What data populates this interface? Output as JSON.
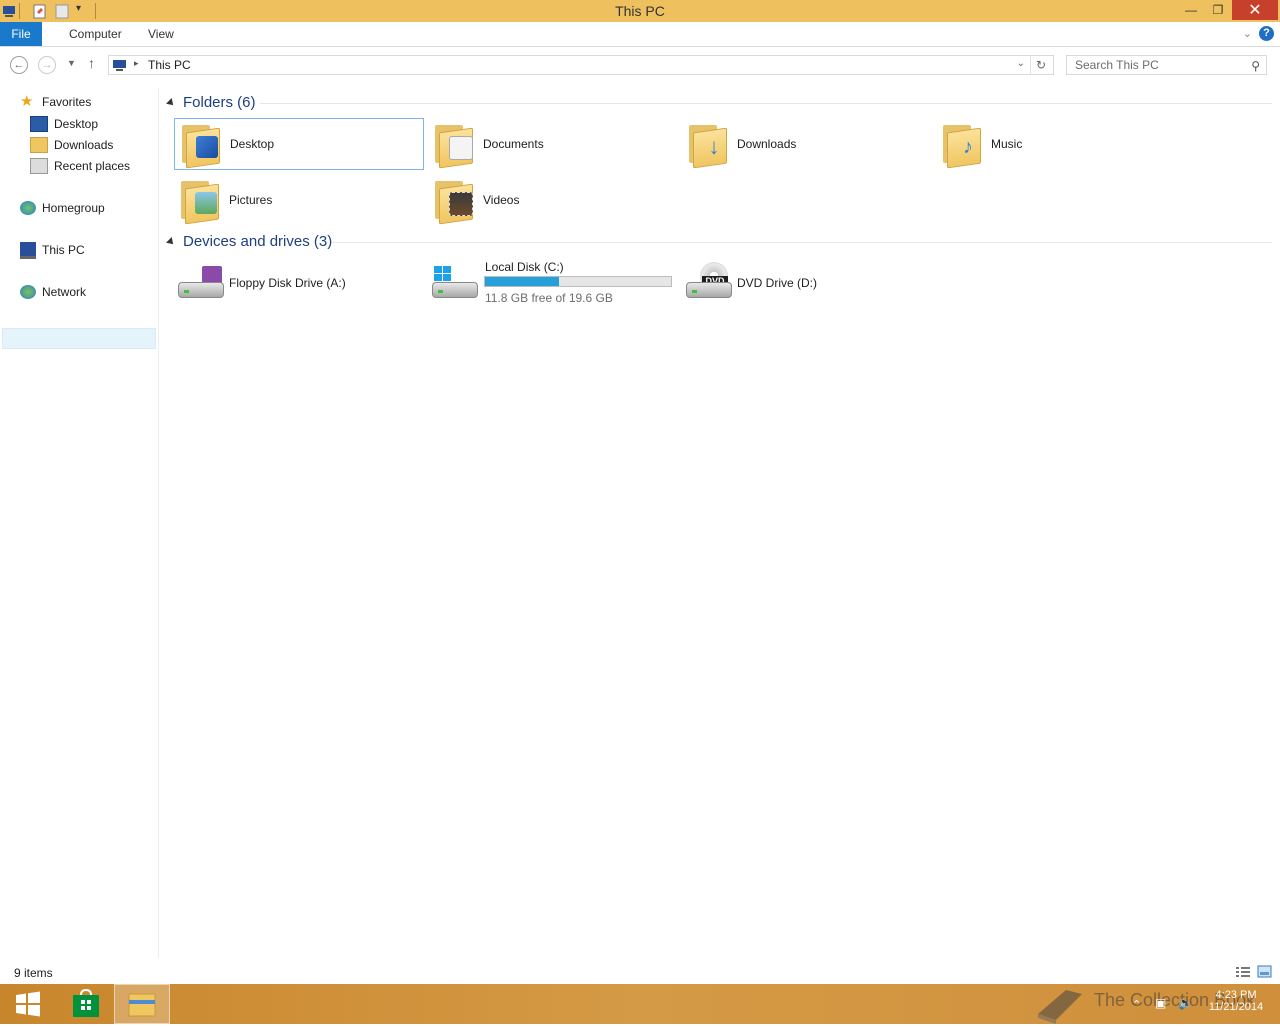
{
  "window": {
    "title": "This PC"
  },
  "ribbon": {
    "tabs": [
      "File",
      "Computer",
      "View"
    ]
  },
  "address": {
    "path": "This PC",
    "search_placeholder": "Search This PC"
  },
  "nav": {
    "favorites": "Favorites",
    "favorites_items": [
      "Desktop",
      "Downloads",
      "Recent places"
    ],
    "homegroup": "Homegroup",
    "this_pc": "This PC",
    "network": "Network"
  },
  "folders": {
    "header": "Folders (6)",
    "items": [
      "Desktop",
      "Documents",
      "Downloads",
      "Music",
      "Pictures",
      "Videos"
    ]
  },
  "devices": {
    "header": "Devices and drives (3)",
    "floppy": "Floppy Disk Drive (A:)",
    "local": {
      "label": "Local Disk (C:)",
      "free_text": "11.8 GB free of 19.6 GB",
      "used_fraction": 0.398
    },
    "dvd": "DVD Drive (D:)",
    "dvd_badge": "DVD"
  },
  "status": {
    "items": "9 items"
  },
  "taskbar": {
    "time": "4:23 PM",
    "date": "11/21/2014",
    "watermark": "The Collection Book"
  },
  "colors": {
    "titlebar": "#efc15e",
    "file_tab": "#1979ca",
    "close": "#c7402b",
    "progress": "#26a0da"
  }
}
